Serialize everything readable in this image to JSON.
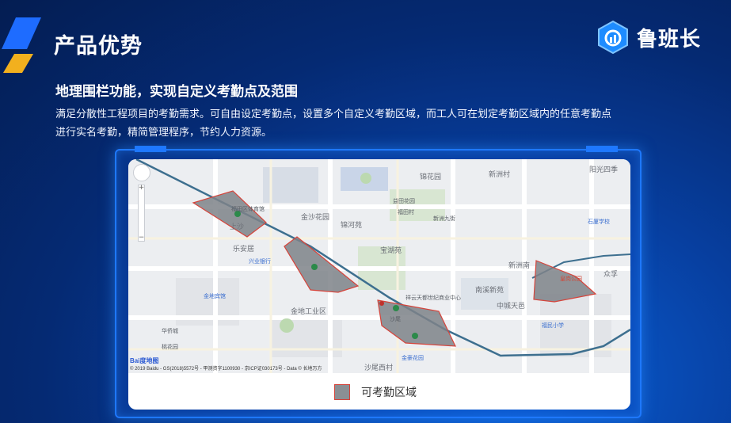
{
  "header": {
    "title": "产品优势",
    "logo_text": "鲁班长"
  },
  "section": {
    "subtitle": "地理围栏功能，实现自定义考勤点及范围",
    "description_line1": "满足分散性工程项目的考勤需求。可自由设定考勤点，设置多个自定义考勤区域，而工人可在划定考勤区域内的任意考勤点",
    "description_line2": "进行实名考勤，精简管理程序，节约人力资源。"
  },
  "map": {
    "baidu_logo": "Bai度地图",
    "copyright": "© 2019 Baidu - GS(2018)5572号 - 甲测资字1100930 - 京ICP证030173号 - Data © 长地万方",
    "labels": [
      "福田区体育馆",
      "上沙",
      "金沙花园",
      "锦河苑",
      "宝湖苑",
      "乐安居",
      "锦花园",
      "新洲南",
      "兴业银行",
      "金地宾馆",
      "金地工业区",
      "沙尾",
      "祥云天都世纪商业中心",
      "南溪新苑",
      "中城天邑",
      "福民小学",
      "金豪花园",
      "沙尾西村",
      "华侨城",
      "桃花园",
      "新洲村",
      "益田花园",
      "福田村",
      "新洲九街",
      "阳光四季",
      "石厦学校",
      "众孚",
      "皇岗公园"
    ]
  },
  "legend": {
    "label": "可考勤区域"
  },
  "colors": {
    "background": "#052a73",
    "frame_border": "#1e78ff",
    "zone_fill": "#8a8f94",
    "zone_border": "#d6433a",
    "metro_line": "#3d6f8f"
  }
}
